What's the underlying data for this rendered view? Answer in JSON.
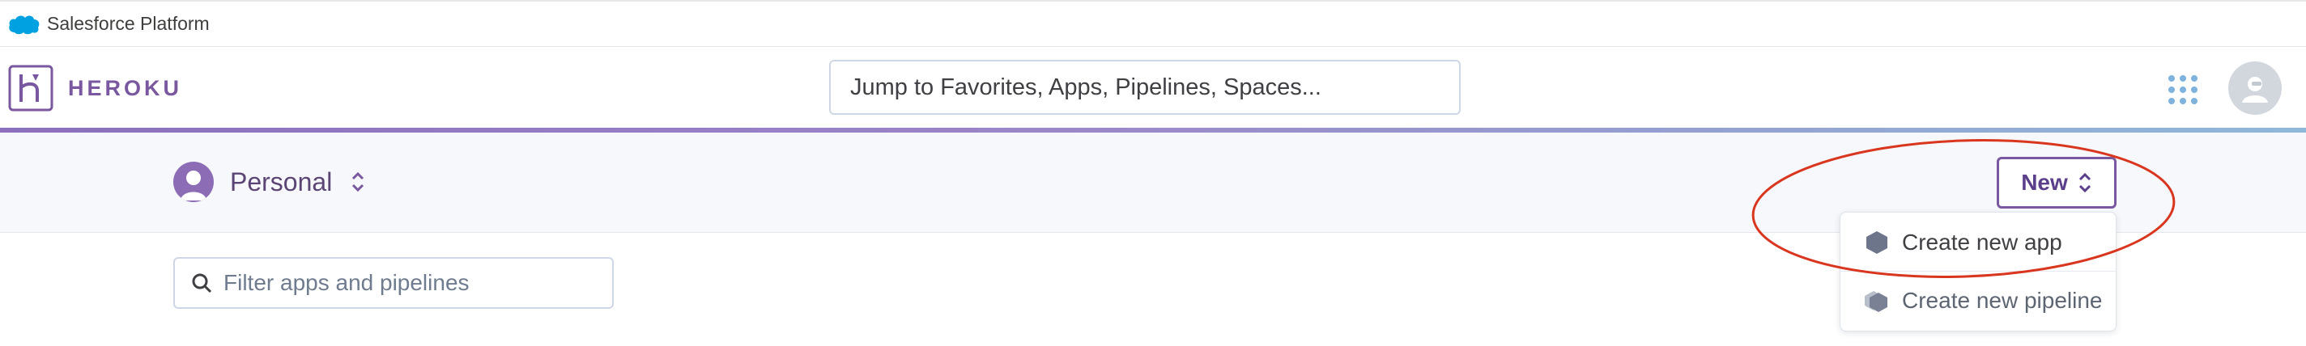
{
  "platform_bar": {
    "label": "Salesforce Platform"
  },
  "header": {
    "brand": "HEROKU",
    "search_placeholder": "Jump to Favorites, Apps, Pipelines, Spaces..."
  },
  "context_bar": {
    "account_label": "Personal",
    "new_button_label": "New"
  },
  "filter": {
    "placeholder": "Filter apps and pipelines"
  },
  "new_menu": {
    "items": [
      {
        "label": "Create new app",
        "icon": "app-hexagon-icon"
      },
      {
        "label": "Create new pipeline",
        "icon": "pipeline-icon"
      }
    ]
  },
  "colors": {
    "brand_purple": "#79589f",
    "annotation_red": "#d9361f",
    "salesforce_blue": "#00a1e0"
  }
}
